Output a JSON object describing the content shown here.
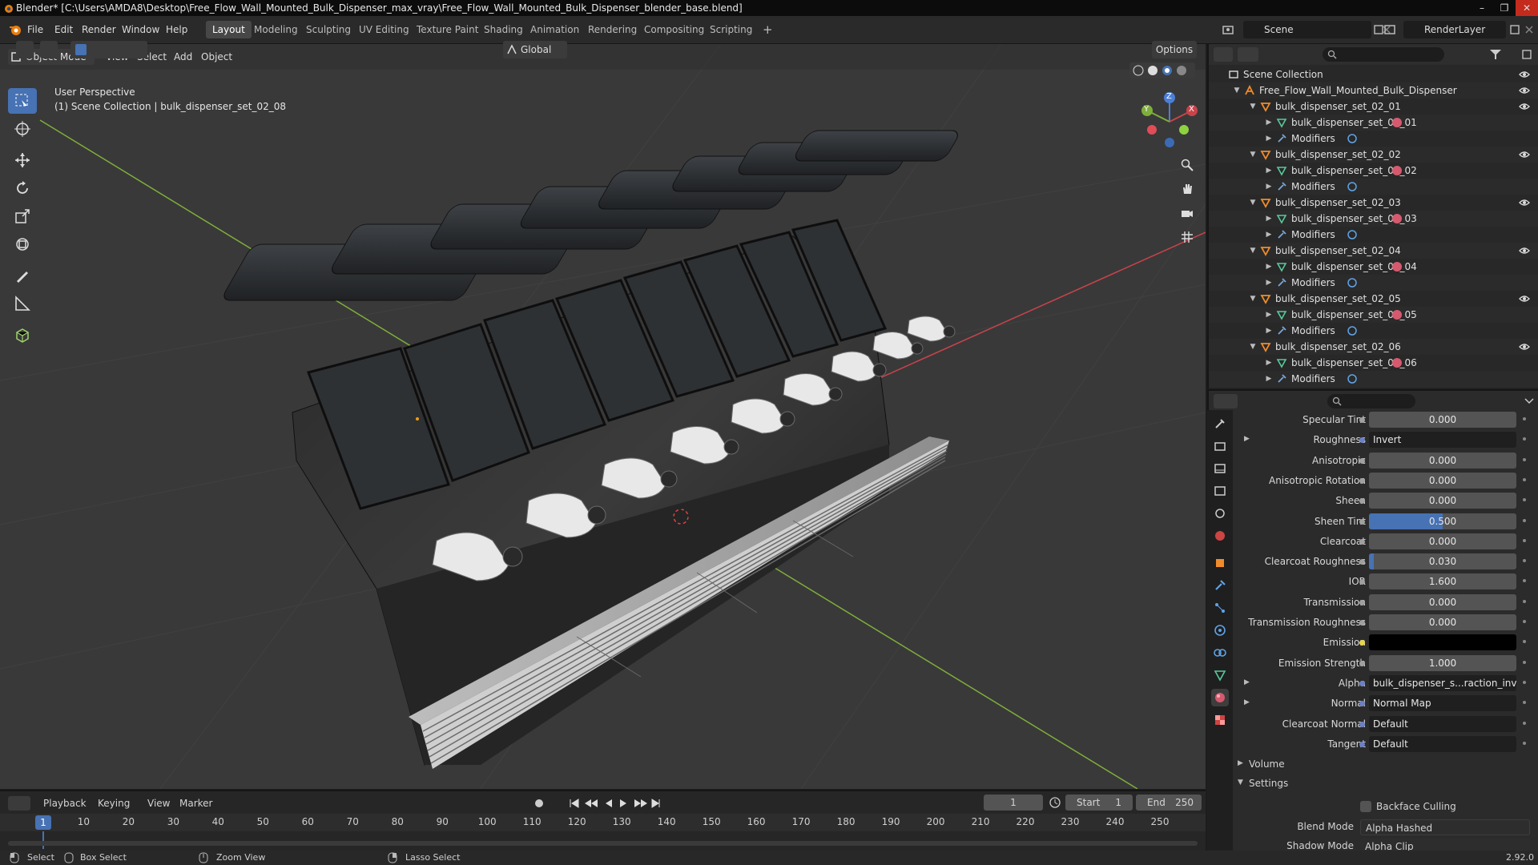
{
  "window": {
    "title": "Blender* [C:\\Users\\AMDA8\\Desktop\\Free_Flow_Wall_Mounted_Bulk_Dispenser_max_vray\\Free_Flow_Wall_Mounted_Bulk_Dispenser_blender_base.blend]"
  },
  "menu": {
    "items": [
      "File",
      "Edit",
      "Render",
      "Window",
      "Help"
    ]
  },
  "workspaces": [
    "Layout",
    "Modeling",
    "Sculpting",
    "UV Editing",
    "Texture Paint",
    "Shading",
    "Animation",
    "Rendering",
    "Compositing",
    "Scripting"
  ],
  "scene": {
    "name": "Scene",
    "render_layer": "RenderLayer"
  },
  "viewport": {
    "mode": "Object Mode",
    "menus": [
      "View",
      "Select",
      "Add",
      "Object"
    ],
    "transform_orientation": "Global",
    "options_label": "Options",
    "info_line1": "User Perspective",
    "info_line2": "(1) Scene Collection | bulk_dispenser_set_02_08",
    "gizmo_x": "X",
    "gizmo_y": "Y",
    "gizmo_z": "Z"
  },
  "outliner": {
    "root": "Scene Collection",
    "top_object": "Free_Flow_Wall_Mounted_Bulk_Dispenser",
    "modifiers_label": "Modifiers",
    "groups": [
      {
        "name": "bulk_dispenser_set_02_01",
        "mesh": "bulk_dispenser_set_02_01"
      },
      {
        "name": "bulk_dispenser_set_02_02",
        "mesh": "bulk_dispenser_set_02_02"
      },
      {
        "name": "bulk_dispenser_set_02_03",
        "mesh": "bulk_dispenser_set_02_03"
      },
      {
        "name": "bulk_dispenser_set_02_04",
        "mesh": "bulk_dispenser_set_02_04"
      },
      {
        "name": "bulk_dispenser_set_02_05",
        "mesh": "bulk_dispenser_set_02_05"
      },
      {
        "name": "bulk_dispenser_set_02_06",
        "mesh": "bulk_dispenser_set_02_06"
      }
    ]
  },
  "properties": {
    "rows": [
      {
        "label": "Specular Tint",
        "value": "0.000",
        "fill": 0
      },
      {
        "label": "Roughness",
        "value": "Invert",
        "kind": "link",
        "expand": true
      },
      {
        "label": "Anisotropic",
        "value": "0.000",
        "fill": 0
      },
      {
        "label": "Anisotropic Rotation",
        "value": "0.000",
        "fill": 0
      },
      {
        "label": "Sheen",
        "value": "0.000",
        "fill": 0
      },
      {
        "label": "Sheen Tint",
        "value": "0.500",
        "fill": 0.5
      },
      {
        "label": "Clearcoat",
        "value": "0.000",
        "fill": 0
      },
      {
        "label": "Clearcoat Roughness",
        "value": "0.030",
        "fill": 0.03
      },
      {
        "label": "IOR",
        "value": "1.600",
        "fill": 0
      },
      {
        "label": "Transmission",
        "value": "0.000",
        "fill": 0
      },
      {
        "label": "Transmission Roughness",
        "value": "0.000",
        "fill": 0
      },
      {
        "label": "Emission",
        "value": "",
        "kind": "color",
        "color": "#000000"
      },
      {
        "label": "Emission Strength",
        "value": "1.000",
        "fill": 0
      },
      {
        "label": "Alpha",
        "value": "bulk_dispenser_s...raction_invert.png",
        "kind": "link",
        "expand": true
      },
      {
        "label": "Normal",
        "value": "Normal Map",
        "kind": "link",
        "expand": true
      },
      {
        "label": "Clearcoat Normal",
        "value": "Default",
        "kind": "link"
      },
      {
        "label": "Tangent",
        "value": "Default",
        "kind": "link"
      }
    ],
    "volume_label": "Volume",
    "settings_label": "Settings",
    "backface_culling": "Backface Culling",
    "blend_mode_label": "Blend Mode",
    "blend_mode": "Alpha Hashed",
    "shadow_mode_label": "Shadow Mode",
    "shadow_mode": "Alpha Clip"
  },
  "timeline": {
    "menus": [
      "Playback",
      "Keying",
      "View",
      "Marker"
    ],
    "current_frame": "1",
    "start_label": "Start",
    "start": "1",
    "end_label": "End",
    "end": "250",
    "ticks": [
      "1",
      "10",
      "20",
      "30",
      "40",
      "50",
      "60",
      "70",
      "80",
      "90",
      "100",
      "110",
      "120",
      "130",
      "140",
      "150",
      "160",
      "170",
      "180",
      "190",
      "200",
      "210",
      "220",
      "230",
      "240",
      "250"
    ]
  },
  "status": {
    "select": "Select",
    "box_select": "Box Select",
    "zoom_view": "Zoom View",
    "lasso_select": "Lasso Select",
    "version": "2.92.0"
  },
  "colors": {
    "accent": "#4772b3",
    "viewport_bg": "#393939",
    "x_axis": "#c9434b",
    "y_axis": "#7fae3a",
    "collection": "#f08c2b",
    "mesh": "#58c99c"
  }
}
